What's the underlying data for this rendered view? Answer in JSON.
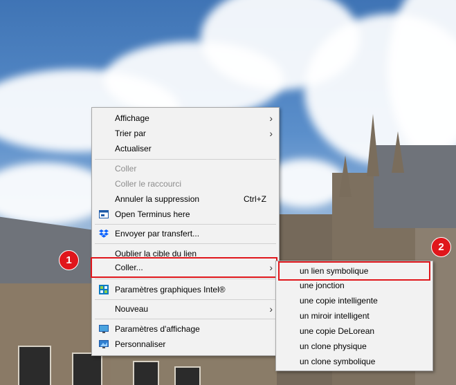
{
  "desktop": {
    "wallpaper": "cathedral-sky"
  },
  "main_menu": {
    "items": [
      {
        "label": "Affichage",
        "submenu": true
      },
      {
        "label": "Trier par",
        "submenu": true
      },
      {
        "label": "Actualiser"
      },
      {
        "label": "Coller",
        "disabled": true
      },
      {
        "label": "Coller le raccourci",
        "disabled": true
      },
      {
        "label": "Annuler la suppression",
        "shortcut": "Ctrl+Z"
      },
      {
        "label": "Open Terminus here",
        "icon": "terminal-icon"
      },
      {
        "label": "Envoyer par transfert...",
        "icon": "dropbox-icon"
      },
      {
        "label": "Oublier la cible du lien"
      },
      {
        "label": "Coller...",
        "submenu": true
      },
      {
        "label": "Paramètres graphiques Intel®",
        "icon": "intel-graphics-icon"
      },
      {
        "label": "Nouveau",
        "submenu": true
      },
      {
        "label": "Paramètres d'affichage",
        "icon": "display-settings-icon"
      },
      {
        "label": "Personnaliser",
        "icon": "personalize-icon"
      }
    ]
  },
  "sub_menu": {
    "items": [
      {
        "label": "un lien symbolique"
      },
      {
        "label": "une jonction"
      },
      {
        "label": "une copie intelligente"
      },
      {
        "label": "un miroir intelligent"
      },
      {
        "label": "une copie DeLorean"
      },
      {
        "label": "un clone physique"
      },
      {
        "label": "un clone symbolique"
      }
    ]
  },
  "annotations": {
    "badge1": "1",
    "badge2": "2"
  },
  "colors": {
    "highlight": "#e0161b",
    "menu_bg": "#f2f2f2",
    "disabled_text": "#8c8c8c"
  }
}
